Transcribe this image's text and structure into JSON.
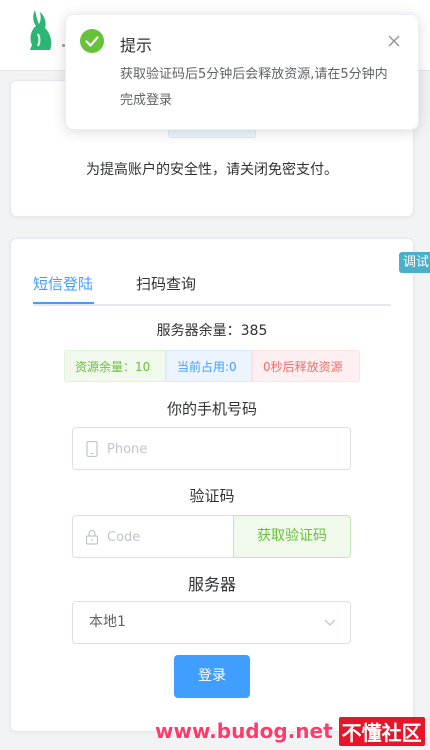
{
  "notice_text": "为提高账户的安全性，请关闭免密支付。",
  "debug_tag": "调试",
  "tabs": [
    {
      "label": "短信登陆",
      "active": true
    },
    {
      "label": "扫码查询",
      "active": false
    }
  ],
  "server_count": "服务器余量：385",
  "tags": {
    "resource": "资源余量：10",
    "current": "当前占用:0",
    "release": "0秒后释放资源"
  },
  "phone": {
    "label": "你的手机号码",
    "placeholder": "Phone",
    "value": ""
  },
  "code": {
    "label": "验证码",
    "placeholder": "Code",
    "value": "",
    "button": "获取验证码"
  },
  "server": {
    "label": "服务器",
    "selected": "本地1"
  },
  "login_button": "登录",
  "toast": {
    "title": "提示",
    "message": "获取验证码后5分钟后会释放资源,请在5分钟内完成登录",
    "icon": "success-check-icon"
  },
  "watermark": {
    "site": "www.budog.net",
    "brand": "不懂社区"
  },
  "colors": {
    "primary": "#409eff",
    "success": "#67c23a",
    "danger": "#f56c6c",
    "logo": "#2bb673"
  }
}
